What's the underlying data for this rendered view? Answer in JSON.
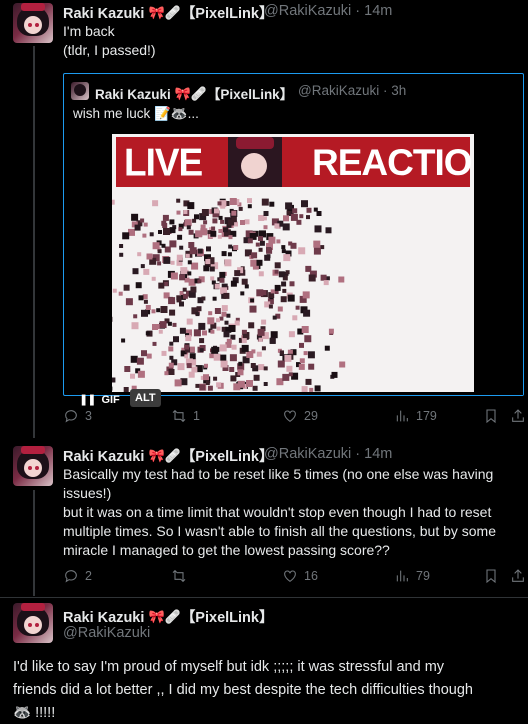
{
  "tweets": [
    {
      "name": "Raki Kazuki",
      "emojis": [
        "🎀",
        "🩹"
      ],
      "tag": "【PixelLink】",
      "handle": "@RakiKazuki · 14m",
      "text": "I'm back\n(tldr, I passed!)",
      "quote": {
        "name": "Raki Kazuki",
        "emojis": [
          "🎀",
          "🩹"
        ],
        "tag": "【PixelLink】",
        "handle": "@RakiKazuki · 3h",
        "text": "wish me luck 📝🦝...",
        "media": {
          "banner_left": "LIVE",
          "banner_right": "REACTION",
          "gif_label": "GIF",
          "alt_label": "ALT",
          "pause_glyph": "❚❚"
        }
      },
      "actions": {
        "replies": "3",
        "reposts": "1",
        "likes": "29",
        "views": "179"
      }
    },
    {
      "name": "Raki Kazuki",
      "emojis": [
        "🎀",
        "🩹"
      ],
      "tag": "【PixelLink】",
      "handle": "@RakiKazuki · 14m",
      "text": "Basically my test had to be reset like 5 times (no one else was having\nissues!)\nbut it was on a time limit that wouldn't stop even though I had to reset\nmultiple times. So I wasn't able to finish all the questions, but by some\nmiracle I managed to get the lowest passing score??",
      "actions": {
        "replies": "2",
        "reposts": "",
        "likes": "16",
        "views": "79"
      }
    },
    {
      "name": "Raki Kazuki",
      "emojis": [
        "🎀",
        "🩹"
      ],
      "tag": "【PixelLink】",
      "handle": "@RakiKazuki",
      "text": "I'd like to say I'm proud of myself but idk ;;;;; it was stressful and my\nfriends did a lot better ,, I did my best despite the tech difficulties though\n🦝 !!!!!"
    }
  ],
  "colors": {
    "background": "#000000",
    "text": "#e7e9ea",
    "muted": "#71767b",
    "accent": "#1d9bf0",
    "divider": "#2f3336",
    "banner_red": "#b51a24"
  },
  "icons": [
    "reply-icon",
    "repost-icon",
    "like-icon",
    "views-icon",
    "bookmark-icon",
    "share-icon",
    "pause-icon"
  ]
}
